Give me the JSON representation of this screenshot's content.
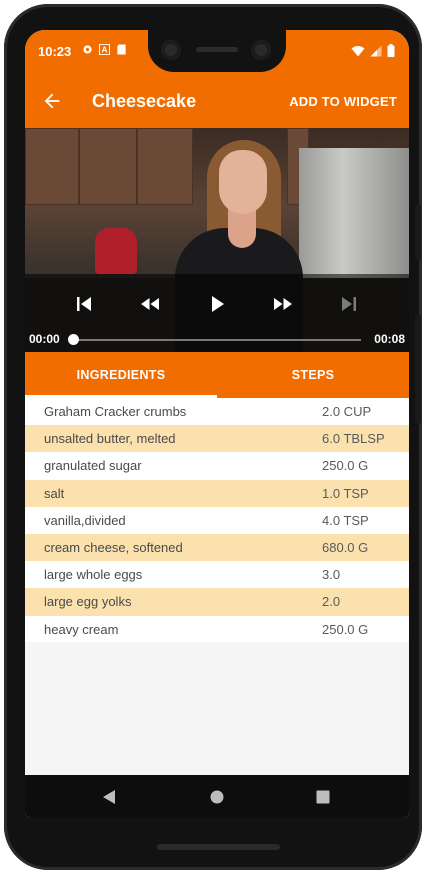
{
  "status_bar": {
    "time": "10:23",
    "left_icons": [
      "settings-icon",
      "text-a-icon",
      "sd-card-icon"
    ],
    "right_icons": [
      "wifi-icon",
      "signal-icon",
      "battery-icon"
    ]
  },
  "app_bar": {
    "title": "Cheesecake",
    "action_label": "ADD TO WIDGET",
    "back_icon": "arrow-back-icon"
  },
  "player": {
    "position": "00:00",
    "duration": "00:08",
    "progress": 0.0,
    "controls": [
      "skip-previous-icon",
      "rewind-icon",
      "play-icon",
      "fast-forward-icon",
      "skip-next-icon"
    ]
  },
  "tabs": [
    {
      "label": "INGREDIENTS",
      "selected": true
    },
    {
      "label": "STEPS",
      "selected": false
    }
  ],
  "ingredients": [
    {
      "name": "Graham Cracker crumbs",
      "quantity": "2.0 CUP"
    },
    {
      "name": "unsalted butter, melted",
      "quantity": "6.0 TBLSP"
    },
    {
      "name": "granulated sugar",
      "quantity": "250.0 G"
    },
    {
      "name": "salt",
      "quantity": "1.0 TSP"
    },
    {
      "name": "vanilla,divided",
      "quantity": "4.0 TSP"
    },
    {
      "name": "cream cheese, softened",
      "quantity": "680.0 G"
    },
    {
      "name": "large whole eggs",
      "quantity": "3.0"
    },
    {
      "name": "large egg yolks",
      "quantity": "2.0"
    },
    {
      "name": "heavy cream",
      "quantity": "250.0 G"
    }
  ],
  "nav_bar": [
    "back-triangle-icon",
    "home-circle-icon",
    "recents-square-icon"
  ],
  "colors": {
    "primary": "#f26d00",
    "row_highlight": "#fbe1ad"
  }
}
